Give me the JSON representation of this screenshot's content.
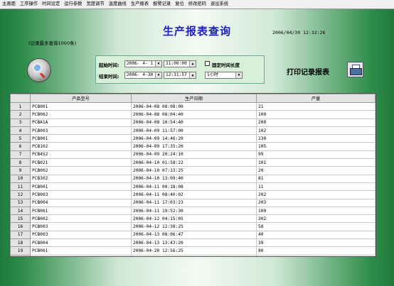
{
  "menu": [
    "主画面",
    "工序操作",
    "时间设定",
    "运行参数",
    "宽度调节",
    "温度曲线",
    "生产报表",
    "报警记录",
    "复位",
    "修改密码",
    "退出系统"
  ],
  "title": "生产报表查询",
  "datetime": "2006/04/30  12:32:26",
  "note": "(记录最多查询1000条)",
  "query": {
    "start_label": "起始时间:",
    "start_date": "2006- 4- 1",
    "start_time": "11:00:00",
    "end_label": "结束时间:",
    "end_date": "2006- 4-30",
    "end_time": "12:31:57",
    "fixed_label": "固定时间长度",
    "duration": "1小时"
  },
  "print_label": "打印记录报表",
  "table": {
    "headers": [
      "产品型号",
      "生产日期",
      "产量"
    ],
    "rows": [
      [
        "1",
        "PCB001",
        "2006-04-08 08:08:00",
        "21"
      ],
      [
        "2",
        "PCB002",
        "2006-04-08 08:04:40",
        "100"
      ],
      [
        "3",
        "PCBA1A",
        "2006-04-08 10:54:40",
        "200"
      ],
      [
        "4",
        "PCB003",
        "2006-04-09 11:57:00",
        "102"
      ],
      [
        "5",
        "PCB001",
        "2006-04-09 14:46:20",
        "230"
      ],
      [
        "6",
        "PCB102",
        "2006-04-09 17:35:20",
        "105"
      ],
      [
        "7",
        "PCB452",
        "2006-04-09 20:24:10",
        "99"
      ],
      [
        "8",
        "PCB021",
        "2006-04-10 01:58:22",
        "101"
      ],
      [
        "9",
        "PCB002",
        "2006-04-10 07:33:25",
        "20"
      ],
      [
        "10",
        "PCB302",
        "2006-04-10 13:09:40",
        "81"
      ],
      [
        "11",
        "PCB001",
        "2006-04-11 00:18:08",
        "11"
      ],
      [
        "12",
        "PCB003",
        "2006-04-11 08:40:02",
        "202"
      ],
      [
        "13",
        "PCB004",
        "2006-04-11 17:03:23",
        "203"
      ],
      [
        "14",
        "PCB001",
        "2006-04-11 19:52:30",
        "100"
      ],
      [
        "15",
        "PCB002",
        "2006-04-12 04:15:05",
        "302"
      ],
      [
        "16",
        "PCB003",
        "2006-04-12 12:38:25",
        "58"
      ],
      [
        "17",
        "PCB003",
        "2006-04-13 08:06:47",
        "40"
      ],
      [
        "18",
        "PCB004",
        "2006-04-13 13:43:20",
        "39"
      ],
      [
        "19",
        "PCB001",
        "2006-04-20 12:56:25",
        "80"
      ],
      [
        "20",
        "PCB002",
        "2006-04-20 10:29:10",
        "100"
      ]
    ]
  }
}
